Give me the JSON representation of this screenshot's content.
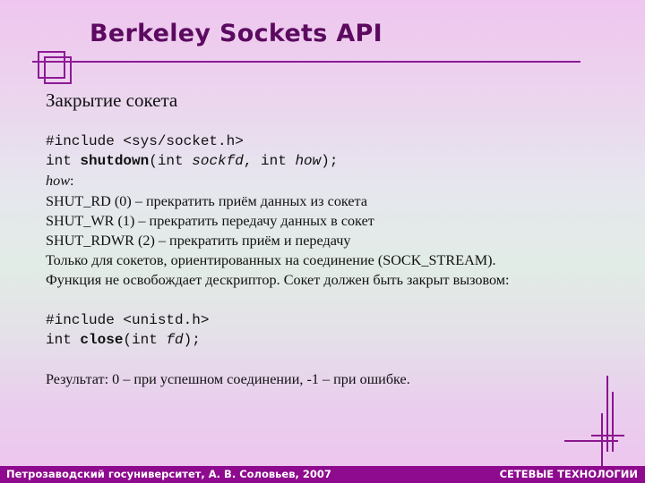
{
  "slide": {
    "title": "Berkeley Sockets API",
    "subtitle": "Закрытие сокета",
    "shutdown": {
      "include": "#include <sys/socket.h>",
      "sig_type": "int ",
      "sig_name": "shutdown",
      "sig_open": "(int ",
      "sig_arg1": "sockfd",
      "sig_mid": ", int ",
      "sig_arg2": "how",
      "sig_close": ");",
      "how_label": "how",
      "how_colon": ":",
      "options": [
        "SHUT_RD (0) – прекратить приём данных из сокета",
        "SHUT_WR (1) – прекратить передачу данных в сокет",
        "SHUT_RDWR (2) – прекратить приём и передачу"
      ],
      "note1": "Только для сокетов, ориентированных на соединение (SOCK_STREAM).",
      "note2": "Функция не освобождает дескриптор. Сокет должен быть закрыт вызовом:"
    },
    "close": {
      "include": "#include <unistd.h>",
      "sig_type": "int ",
      "sig_name": "close",
      "sig_open": "(int ",
      "sig_arg": "fd",
      "sig_close": ");"
    },
    "result": "Результат: 0 – при успешном соединении, -1 – при ошибке."
  },
  "footer": {
    "left": "Петрозаводский госуниверситет, А. В. Соловьев, 2007",
    "right": "СЕТЕВЫЕ ТЕХНОЛОГИИ"
  },
  "colors": {
    "accent": "#8e1a96",
    "title": "#5c0a60",
    "footer_bg": "#8e0a8e"
  }
}
